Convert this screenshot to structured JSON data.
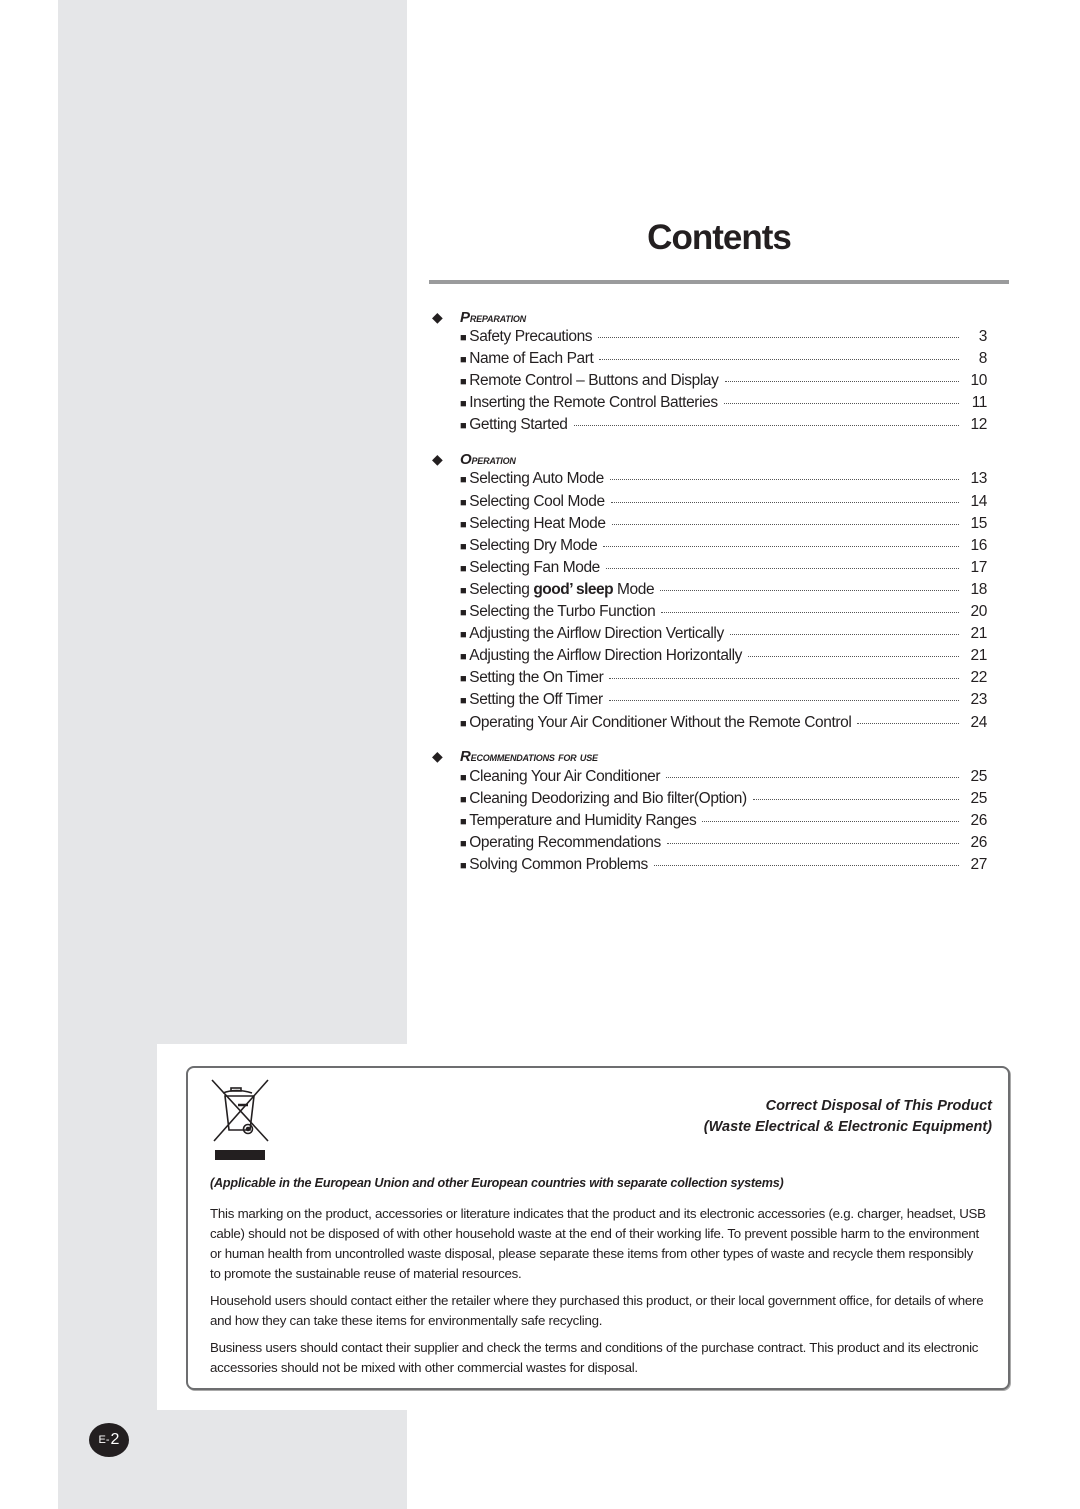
{
  "page_title": "Contents",
  "toc": [
    {
      "section": "Preparation",
      "entries": [
        {
          "text": "Safety Precautions",
          "page": "3"
        },
        {
          "text": "Name of Each Part",
          "page": "8"
        },
        {
          "text": "Remote Control – Buttons and Display",
          "page": "10"
        },
        {
          "text": "Inserting the Remote Control Batteries",
          "page": "11"
        },
        {
          "text": "Getting Started",
          "page": "12"
        }
      ]
    },
    {
      "section": "Operation",
      "entries": [
        {
          "text": "Selecting Auto Mode",
          "page": "13"
        },
        {
          "text": "Selecting Cool Mode",
          "page": "14"
        },
        {
          "text": "Selecting Heat Mode",
          "page": "15"
        },
        {
          "text": "Selecting Dry Mode",
          "page": "16"
        },
        {
          "text": "Selecting Fan Mode",
          "page": "17"
        },
        {
          "text_before": "Selecting ",
          "text_brand": "good’ sleep",
          "text_after": " Mode",
          "page": "18"
        },
        {
          "text": "Selecting the Turbo Function",
          "page": "20"
        },
        {
          "text": "Adjusting the Airflow Direction Vertically",
          "page": "21"
        },
        {
          "text": "Adjusting the Airflow Direction Horizontally",
          "page": "21"
        },
        {
          "text": "Setting the On Timer",
          "page": "22"
        },
        {
          "text": "Setting the Off Timer",
          "page": "23"
        },
        {
          "text": "Operating Your Air Conditioner Without the Remote Control",
          "page": "24"
        }
      ]
    },
    {
      "section": "Recommendations for use",
      "entries": [
        {
          "text": "Cleaning Your Air Conditioner",
          "page": "25"
        },
        {
          "text": "Cleaning Deodorizing and Bio filter(Option)",
          "page": "25"
        },
        {
          "text": "Temperature and Humidity Ranges",
          "page": "26"
        },
        {
          "text": "Operating Recommendations",
          "page": "26"
        },
        {
          "text": "Solving Common Problems",
          "page": "27"
        }
      ]
    }
  ],
  "notice": {
    "icon": "weee-crossed-bin-icon",
    "title_line1": "Correct Disposal of This Product",
    "title_line2": "(Waste Electrical & Electronic Equipment)",
    "applicable": "(Applicable in the European Union and other European countries with separate collection systems)",
    "paragraphs": [
      "This marking on the product, accessories or literature indicates that the product and its electronic accessories (e.g. charger, headset, USB cable) should not be disposed of with other household waste at the end of their working life. To prevent possible harm to the environment or human health from uncontrolled waste disposal, please separate these items from other types of waste and recycle them responsibly to promote the sustainable reuse of material resources.",
      "Household users should contact either the retailer where they purchased this product, or their local government office, for details of where and how they can take these items for environmentally safe recycling.",
      "Business users should contact their supplier and check the terms and conditions of the purchase contract. This product and its electronic accessories should not be mixed with other commercial wastes for disposal."
    ]
  },
  "page_number": {
    "prefix": "E-",
    "number": "2"
  },
  "colors": {
    "gray_panel": "#e5e6e8",
    "divider": "#9a9b9c",
    "text": "#231f20"
  }
}
